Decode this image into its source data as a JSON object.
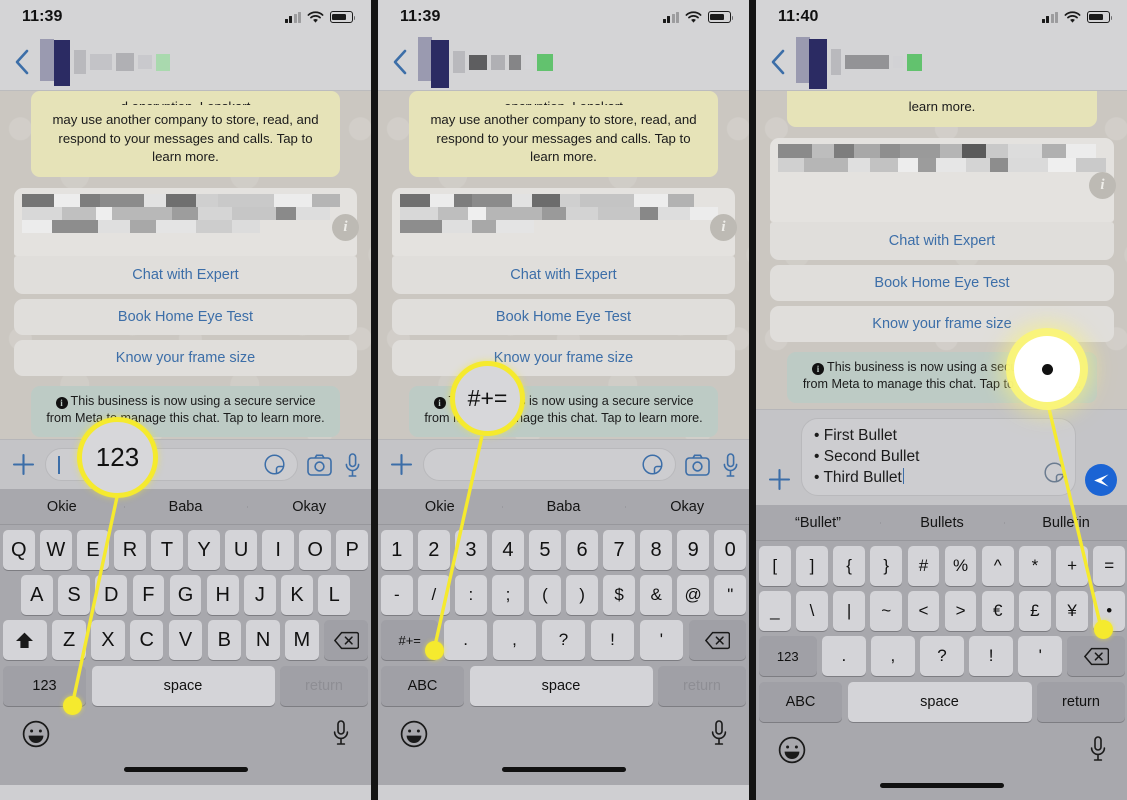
{
  "panels": [
    {
      "id": "panel-1",
      "status": {
        "time": "11:39",
        "signal": "signal-bars-icon",
        "wifi": "wifi-icon",
        "battery": "battery-icon"
      },
      "nav": {
        "back": "back-chevron-icon",
        "contact_name_redacted": "redacted-contact-name"
      },
      "chat": {
        "notice": "may use another company to store, read, and respond to your messages and calls. Tap to learn more.",
        "notice_clipped_top": "d encryption. Lenskart",
        "card_info_badge": "i",
        "ctas": [
          "Chat with Expert",
          "Book Home Eye Test",
          "Know your frame size"
        ],
        "system_message": "This business is now using a secure service from Meta to manage this chat. Tap to learn more."
      },
      "input": {
        "plus": "plus-icon",
        "value": "",
        "sticker": "sticker-icon",
        "camera": "camera-icon",
        "mic": "mic-icon",
        "has_send": false
      },
      "keyboard": {
        "layout": "letters",
        "predictions": [
          "Okie",
          "Baba",
          "Okay"
        ],
        "row1": [
          "Q",
          "W",
          "E",
          "R",
          "T",
          "Y",
          "U",
          "I",
          "O",
          "P"
        ],
        "row2": [
          "A",
          "S",
          "D",
          "F",
          "G",
          "H",
          "J",
          "K",
          "L"
        ],
        "row3_left": "shift-icon",
        "row3": [
          "Z",
          "X",
          "C",
          "V",
          "B",
          "N",
          "M"
        ],
        "row3_right": "backspace-icon",
        "mode_key": "123",
        "space_key": "space",
        "return_key": "return",
        "return_enabled": false
      },
      "bottom": {
        "emoji": "emoji-icon",
        "mic": "mic-icon"
      },
      "annotation": {
        "label": "123",
        "type": "magnifier"
      }
    },
    {
      "id": "panel-2",
      "status": {
        "time": "11:39",
        "signal": "signal-bars-icon",
        "wifi": "wifi-icon",
        "battery": "battery-icon"
      },
      "nav": {
        "back": "back-chevron-icon",
        "contact_name_redacted": "redacted-contact-name"
      },
      "chat": {
        "notice": "may use another company to store, read, and respond to your messages and calls. Tap to learn more.",
        "notice_clipped_top": "encryption. Lenskart",
        "card_info_badge": "i",
        "ctas": [
          "Chat with Expert",
          "Book Home Eye Test",
          "Know your frame size"
        ],
        "system_message": "This business is now using a secure service from Meta to manage this chat. Tap to learn more."
      },
      "input": {
        "plus": "plus-icon",
        "value": "",
        "sticker": "sticker-icon",
        "camera": "camera-icon",
        "mic": "mic-icon",
        "has_send": false
      },
      "keyboard": {
        "layout": "numbers",
        "predictions": [
          "Okie",
          "Baba",
          "Okay"
        ],
        "row1": [
          "1",
          "2",
          "3",
          "4",
          "5",
          "6",
          "7",
          "8",
          "9",
          "0"
        ],
        "row2": [
          "-",
          "/",
          ":",
          ";",
          "(",
          ")",
          "$",
          "&",
          "@",
          "\""
        ],
        "row3_left": "#+=",
        "row3": [
          ".",
          ",",
          "?",
          "!",
          "'"
        ],
        "row3_right": "backspace-icon",
        "mode_key": "ABC",
        "space_key": "space",
        "return_key": "return",
        "return_enabled": false
      },
      "bottom": {
        "emoji": "emoji-icon",
        "mic": "mic-icon"
      },
      "annotation": {
        "label": "#+=",
        "type": "magnifier"
      }
    },
    {
      "id": "panel-3",
      "status": {
        "time": "11:40",
        "signal": "signal-bars-icon",
        "wifi": "wifi-icon",
        "battery": "battery-icon"
      },
      "nav": {
        "back": "back-chevron-icon",
        "contact_name_redacted": "redacted-contact-name"
      },
      "chat": {
        "notice": "learn more.",
        "notice_clipped_top": "",
        "card_info_badge": "i",
        "ctas": [
          "Chat with Expert",
          "Book Home Eye Test",
          "Know your frame size"
        ],
        "system_message": "This business is now using a secure service from Meta to manage this chat. Tap to learn more."
      },
      "input": {
        "plus": "plus-icon",
        "value": [
          "First Bullet",
          "Second Bullet",
          "Third Bullet"
        ],
        "bullet_char": "•",
        "sticker": "sticker-icon",
        "camera": "camera-icon",
        "mic": "mic-icon",
        "has_send": true,
        "send": "send-icon"
      },
      "keyboard": {
        "layout": "symbols",
        "predictions": [
          "“Bullet”",
          "Bullets",
          "Bulletin"
        ],
        "row1": [
          "[",
          "]",
          "{",
          "}",
          "#",
          "%",
          "^",
          "*",
          "+",
          "="
        ],
        "row2": [
          "_",
          "\\",
          "|",
          "~",
          "<",
          ">",
          "€",
          "£",
          "¥",
          "•"
        ],
        "row3_left": "123",
        "row3": [
          ".",
          ",",
          "?",
          "!",
          "'"
        ],
        "row3_right": "backspace-icon",
        "mode_key": "ABC",
        "space_key": "space",
        "return_key": "return",
        "return_enabled": true
      },
      "bottom": {
        "emoji": "emoji-icon",
        "mic": "mic-icon"
      },
      "annotation": {
        "label": "•",
        "type": "glow-dot"
      }
    }
  ],
  "colors": {
    "callout_yellow": "#f5ea2e",
    "link_blue": "#3c6ea8",
    "send_blue": "#1b64d4",
    "notice_yellow_bg": "#e6e3b8",
    "system_bg": "#bdcbc5",
    "keyboard_bg": "#a8a8ad",
    "key_bg": "#d4d4d8",
    "key_dark_bg": "#a0a0a6"
  }
}
